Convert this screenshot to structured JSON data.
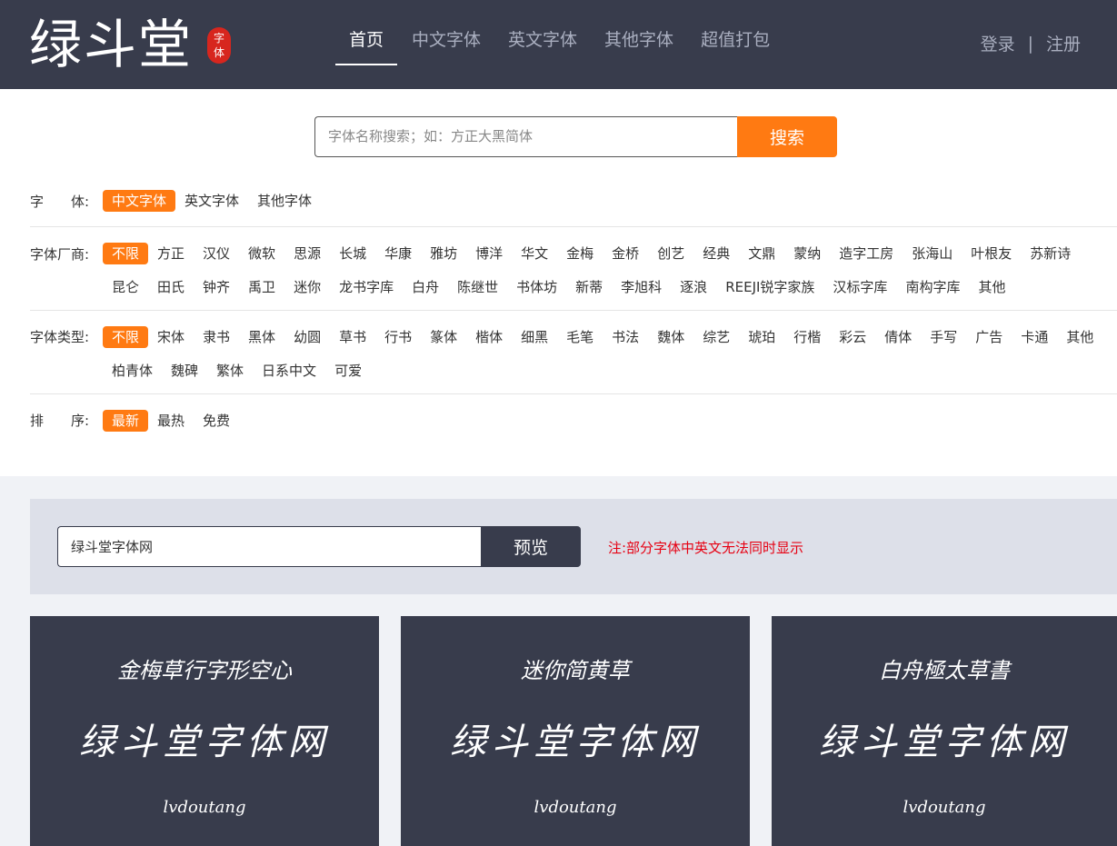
{
  "header": {
    "logo_text": "绿斗堂",
    "logo_badge": [
      "字",
      "体"
    ],
    "nav": [
      "首页",
      "中文字体",
      "英文字体",
      "其他字体",
      "超值打包"
    ],
    "login": "登录",
    "separator": "|",
    "register": "注册"
  },
  "search": {
    "placeholder": "字体名称搜索；如：方正大黑简体",
    "button": "搜索"
  },
  "filters": {
    "font": {
      "label": "字　　体:",
      "options": [
        "中文字体",
        "英文字体",
        "其他字体"
      ]
    },
    "maker": {
      "label": "字体厂商:",
      "options": [
        "不限",
        "方正",
        "汉仪",
        "微软",
        "思源",
        "长城",
        "华康",
        "雅坊",
        "博洋",
        "华文",
        "金梅",
        "金桥",
        "创艺",
        "经典",
        "文鼎",
        "蒙纳",
        "造字工房",
        "张海山",
        "叶根友",
        "苏新诗",
        "昆仑",
        "田氏",
        "钟齐",
        "禹卫",
        "迷你",
        "龙书字库",
        "白舟",
        "陈继世",
        "书体坊",
        "新蒂",
        "李旭科",
        "逐浪",
        "REEJI锐字家族",
        "汉标字库",
        "南构字库",
        "其他"
      ]
    },
    "type": {
      "label": "字体类型:",
      "options": [
        "不限",
        "宋体",
        "隶书",
        "黑体",
        "幼圆",
        "草书",
        "行书",
        "篆体",
        "楷体",
        "细黑",
        "毛笔",
        "书法",
        "魏体",
        "综艺",
        "琥珀",
        "行楷",
        "彩云",
        "倩体",
        "手写",
        "广告",
        "卡通",
        "其他",
        "柏青体",
        "魏碑",
        "繁体",
        "日系中文",
        "可爱"
      ]
    },
    "sort": {
      "label": "排　　序:",
      "options": [
        "最新",
        "最热",
        "免费"
      ]
    }
  },
  "preview": {
    "input_value": "绿斗堂字体网",
    "button": "预览",
    "note": "注:部分字体中英文无法同时显示"
  },
  "cards": [
    {
      "name": "金梅草行字形空心",
      "sample": "绿斗堂字体网",
      "latin": "lvdoutang"
    },
    {
      "name": "迷你简黄草",
      "sample": "绿斗堂字体网",
      "latin": "lvdoutang"
    },
    {
      "name": "白舟極太草書",
      "sample": "绿斗堂字体网",
      "latin": "lvdoutang"
    }
  ]
}
